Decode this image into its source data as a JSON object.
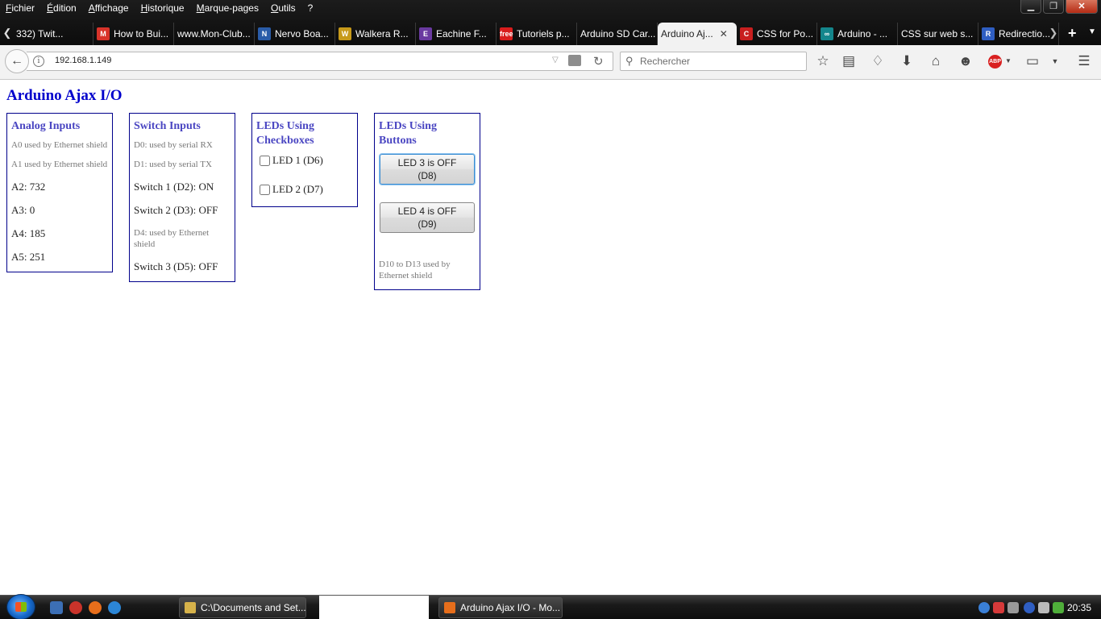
{
  "menubar": {
    "items": [
      "Fichier",
      "Édition",
      "Affichage",
      "Historique",
      "Marque-pages",
      "Outils",
      "?"
    ]
  },
  "window_controls": {
    "minimize": "▁",
    "restore": "❐",
    "close": "✕"
  },
  "tabs": [
    {
      "label": "332) Twit...",
      "icon": "none",
      "icon_color": ""
    },
    {
      "label": "How to Bui...",
      "icon": "M",
      "icon_color": "#d8332a"
    },
    {
      "label": "www.Mon-Club...",
      "icon": "none",
      "icon_color": ""
    },
    {
      "label": "Nervo Boa...",
      "icon": "N",
      "icon_color": "#2a5ca8"
    },
    {
      "label": "Walkera R...",
      "icon": "W",
      "icon_color": "#c79a1a"
    },
    {
      "label": "Eachine F...",
      "icon": "E",
      "icon_color": "#6a3aa0"
    },
    {
      "label": "Tutoriels p...",
      "icon": "free",
      "icon_color": "#d91c1c"
    },
    {
      "label": "Arduino SD Car...",
      "icon": "none",
      "icon_color": ""
    },
    {
      "label": "Arduino Aj...",
      "icon": "none",
      "icon_color": "",
      "active": true
    },
    {
      "label": "CSS for Po...",
      "icon": "C",
      "icon_color": "#c81f1f"
    },
    {
      "label": "Arduino - ...",
      "icon": "∞",
      "icon_color": "#14868c"
    },
    {
      "label": "CSS sur web s...",
      "icon": "none",
      "icon_color": ""
    },
    {
      "label": "Redirectio...",
      "icon": "R",
      "icon_color": "#2f5ec2"
    }
  ],
  "navbar": {
    "url": "192.168.1.149",
    "search_placeholder": "Rechercher"
  },
  "page": {
    "title": "Arduino Ajax I/O",
    "analog": {
      "title": "Analog Inputs",
      "notes": [
        "A0 used by Ethernet shield",
        "A1 used by Ethernet shield"
      ],
      "values": [
        "A2: 732",
        "A3: 0",
        "A4: 185",
        "A5: 251"
      ]
    },
    "switches": {
      "title": "Switch Inputs",
      "note_d0": "D0: used by serial RX",
      "note_d1": "D1: used by serial TX",
      "switch1": "Switch 1 (D2): ON",
      "switch2": "Switch 2 (D3): OFF",
      "note_d4": "D4: used by Ethernet shield",
      "switch3": "Switch 3 (D5): OFF"
    },
    "checkboxes": {
      "title": "LEDs Using Checkboxes",
      "led1": "LED 1 (D6)",
      "led2": "LED 2 (D7)"
    },
    "buttons": {
      "title": "LEDs Using Buttons",
      "led3_line1": "LED 3 is OFF",
      "led3_line2": "(D8)",
      "led4_line1": "LED 4 is OFF",
      "led4_line2": "(D9)",
      "note": "D10 to D13 used by Ethernet shield"
    }
  },
  "taskbar": {
    "items": [
      {
        "label": "C:\\Documents and Set...",
        "icon_color": "#d6b24a"
      },
      {
        "label": "Arduino Ajax I/O - Mo...",
        "icon_color": "#e76e1b"
      }
    ],
    "clock": "20:35"
  }
}
